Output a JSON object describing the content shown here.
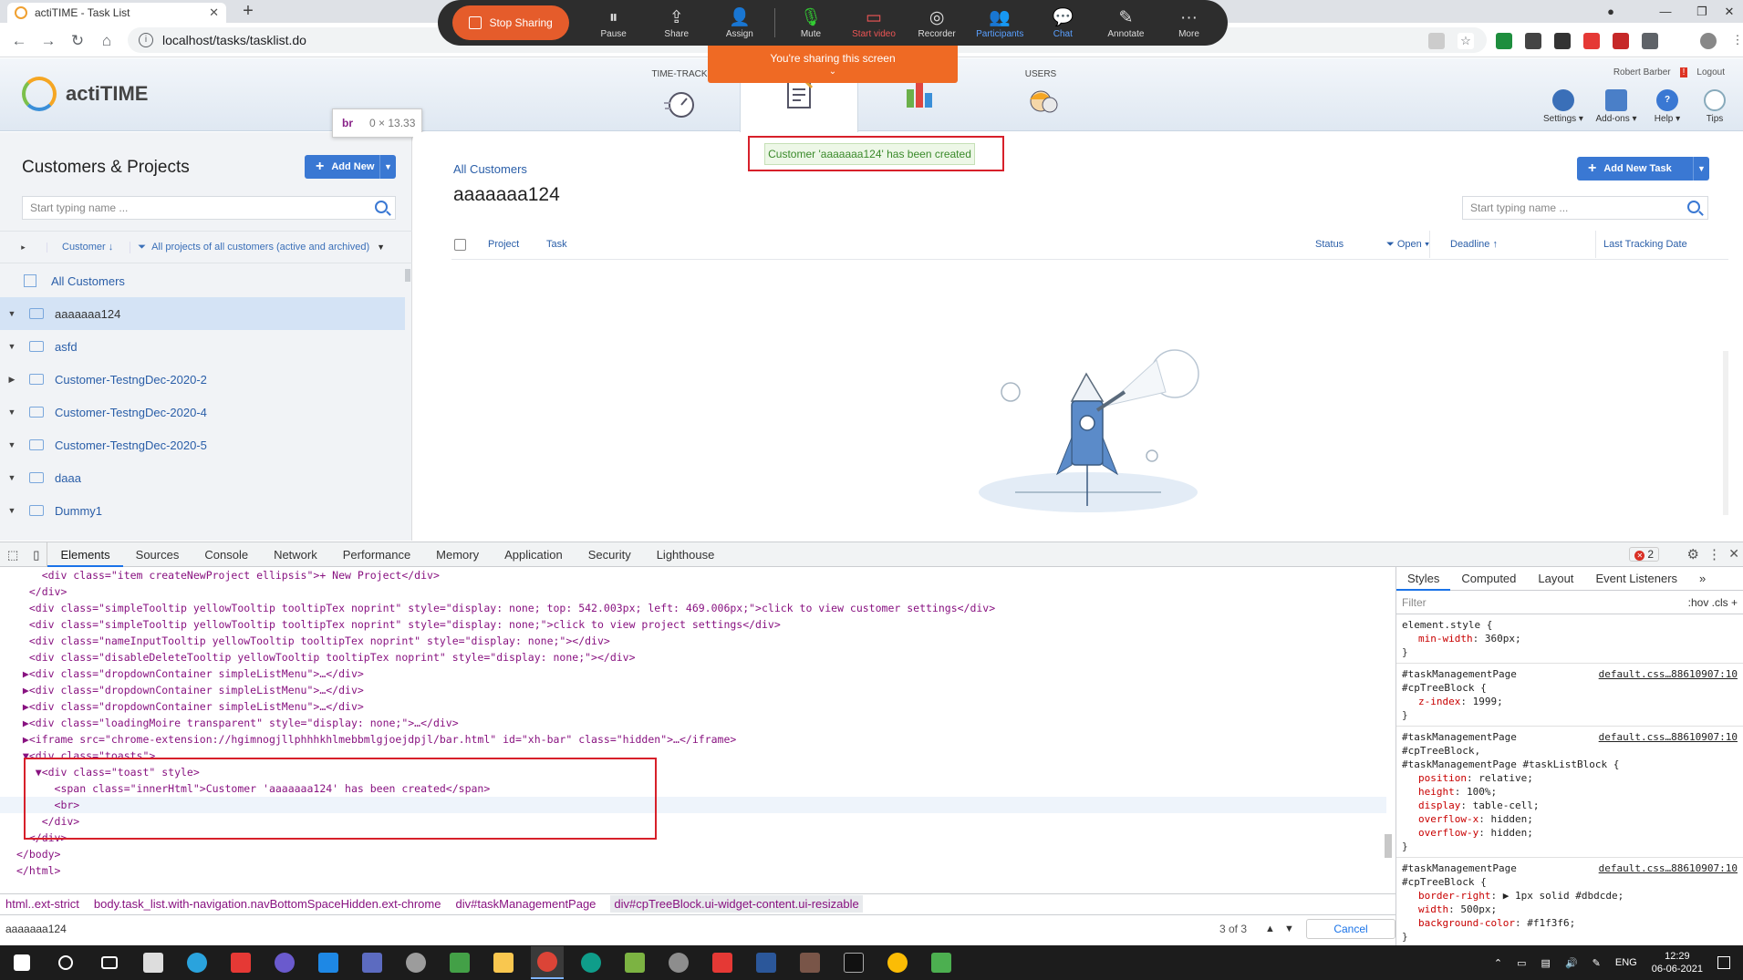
{
  "browser": {
    "tab_title": "actiTIME - Task List",
    "url": "localhost/tasks/tasklist.do"
  },
  "zoom": {
    "stop_sharing": "Stop Sharing",
    "items": [
      "Pause",
      "Share",
      "Assign",
      "Mute",
      "Start video",
      "Recorder",
      "Participants",
      "Chat",
      "Annotate",
      "More"
    ],
    "banner": "You're sharing this screen"
  },
  "app": {
    "logo": "actiTIME",
    "modules": [
      "TIME-TRACK",
      "",
      "",
      "USERS"
    ],
    "user_name": "Robert Barber",
    "logout": "Logout",
    "tools": [
      "Settings",
      "Add-ons",
      "Help",
      "Tips"
    ]
  },
  "tooltip": {
    "tag": "br",
    "size": "0 × 13.33"
  },
  "left": {
    "title": "Customers & Projects",
    "add_new": "Add New",
    "search_placeholder": "Start typing name ...",
    "filter_customer": "Customer",
    "filter_projects": "All projects of all customers (active and archived)",
    "all_customers": "All Customers",
    "items": [
      "aaaaaaa124",
      "asfd",
      "Customer-TestngDec-2020-2",
      "Customer-TestngDec-2020-4",
      "Customer-TestngDec-2020-5",
      "daaa",
      "Dummy1"
    ]
  },
  "main": {
    "breadcrumb": "All Customers",
    "title": "aaaaaaa124",
    "add_task": "Add New Task",
    "search_placeholder": "Start typing name ...",
    "toast": "Customer 'aaaaaaa124' has been created",
    "columns": {
      "project": "Project",
      "task": "Task",
      "status": "Status",
      "open": "Open",
      "deadline": "Deadline",
      "last_tracking": "Last Tracking Date"
    }
  },
  "devtools": {
    "tabs": [
      "Elements",
      "Sources",
      "Console",
      "Network",
      "Performance",
      "Memory",
      "Application",
      "Security",
      "Lighthouse"
    ],
    "error_count": "2",
    "breadcrumbs": [
      "html..ext-strict",
      "body.task_list.with-navigation.navBottomSpaceHidden.ext-chrome",
      "div#taskManagementPage",
      "div#cpTreeBlock.ui-widget-content.ui-resizable"
    ],
    "search_value": "aaaaaaa124",
    "search_count": "3 of 3",
    "cancel": "Cancel",
    "style_tabs": [
      "Styles",
      "Computed",
      "Layout",
      "Event Listeners"
    ],
    "filter_placeholder": "Filter",
    "filter_buttons": ":hov  .cls  +",
    "code_lines": [
      "    <div class=\"item createNewProject ellipsis\">+ New Project</div>",
      "  </div>",
      "  <div class=\"simpleTooltip yellowTooltip tooltipTex noprint\" style=\"display: none; top: 542.003px; left: 469.006px;\">click to view customer settings</div>",
      "  <div class=\"simpleTooltip yellowTooltip tooltipTex noprint\" style=\"display: none;\">click to view project settings</div>",
      "  <div class=\"nameInputTooltip yellowTooltip tooltipTex noprint\" style=\"display: none;\"></div>",
      "  <div class=\"disableDeleteTooltip yellowTooltip tooltipTex noprint\" style=\"display: none;\"></div>",
      " ▶<div class=\"dropdownContainer simpleListMenu\">…</div>",
      " ▶<div class=\"dropdownContainer simpleListMenu\">…</div>",
      " ▶<div class=\"dropdownContainer simpleListMenu\">…</div>",
      " ▶<div class=\"loadingMoire transparent\" style=\"display: none;\">…</div>",
      " ▶<iframe src=\"chrome-extension://hgimnogjllphhhkhlmebbmlgjoejdpjl/bar.html\" id=\"xh-bar\" class=\"hidden\">…</iframe>",
      " ▼<div class=\"toasts\">",
      "   ▼<div class=\"toast\" style>",
      "      <span class=\"innerHtml\">Customer 'aaaaaaa124' has been created</span>",
      "      <br>",
      "    </div>",
      "  </div>",
      "</body>",
      "</html>"
    ],
    "rules": [
      {
        "selector": "element.style {",
        "source": "",
        "props": [
          [
            "min-width",
            "360px;"
          ]
        ]
      },
      {
        "selector": "#taskManagementPage\n#cpTreeBlock {",
        "source": "default.css…88610907:10",
        "props": [
          [
            "z-index",
            "1999;"
          ]
        ]
      },
      {
        "selector": "#taskManagementPage\n#cpTreeBlock,\n#taskManagementPage #taskListBlock {",
        "source": "default.css…88610907:10",
        "props": [
          [
            "position",
            "relative;"
          ],
          [
            "height",
            "100%;"
          ],
          [
            "display",
            "table-cell;"
          ],
          [
            "overflow-x",
            "hidden;"
          ],
          [
            "overflow-y",
            "hidden;"
          ]
        ]
      },
      {
        "selector": "#taskManagementPage\n#cpTreeBlock {",
        "source": "default.css…88610907:10",
        "props": [
          [
            "border-right",
            "▶ 1px solid #dbdcde;"
          ],
          [
            "width",
            "500px;"
          ],
          [
            "background-color",
            "#f1f3f6;"
          ]
        ]
      }
    ]
  },
  "taskbar": {
    "lang": "ENG",
    "time": "12:29",
    "date": "06-06-2021"
  },
  "colors": {
    "accent": "#3a78d3",
    "toast_bg": "#edf7e7",
    "highlight": "#d7202a",
    "selected_row": "#d4e3f5"
  }
}
